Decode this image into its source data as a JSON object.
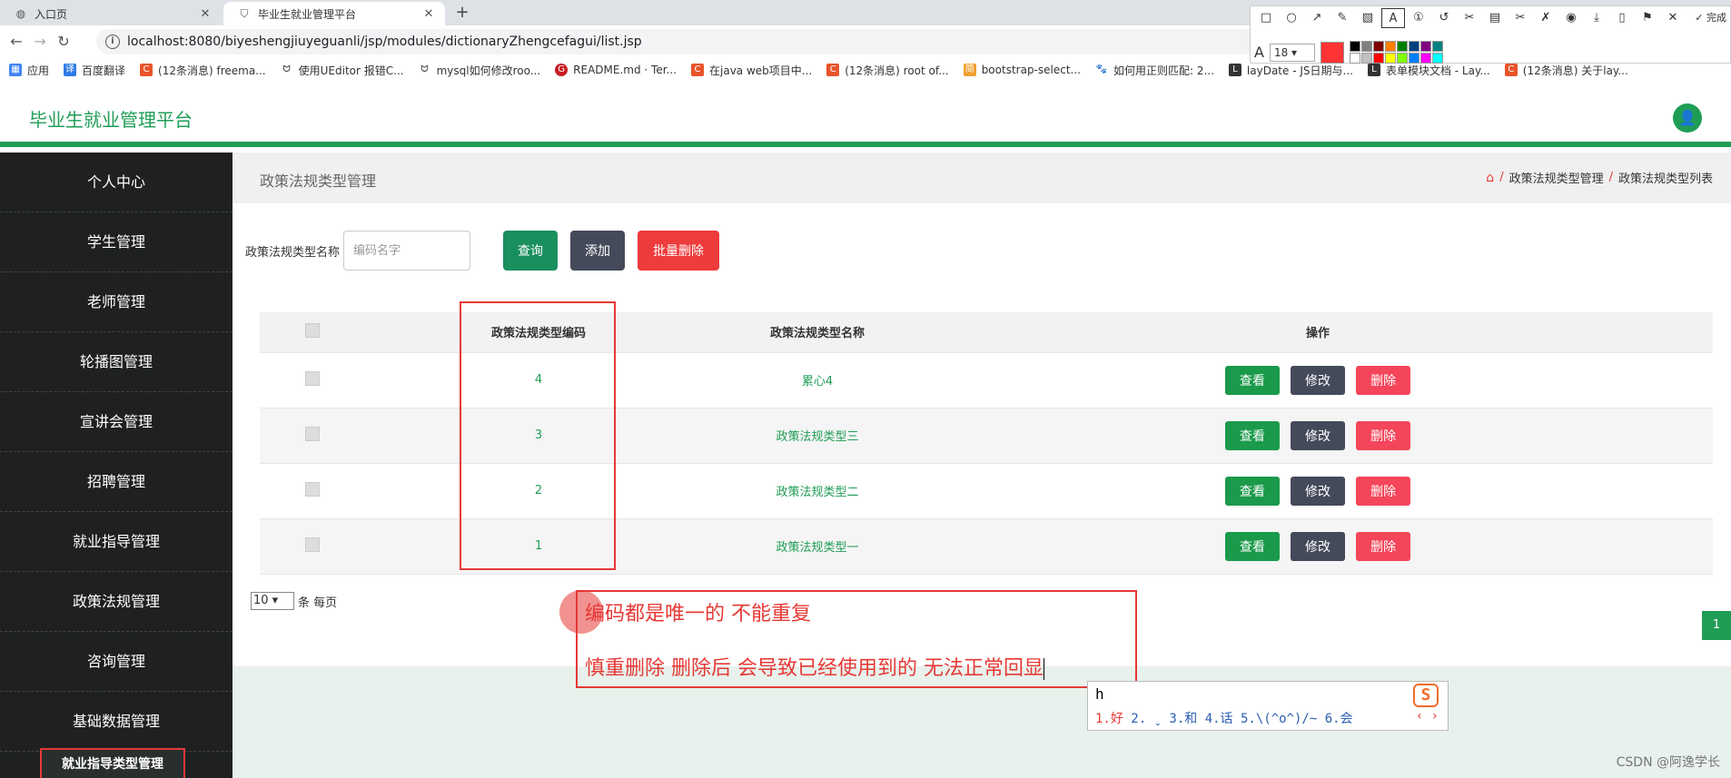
{
  "browser": {
    "tabs": [
      {
        "label": "入口页",
        "active": false
      },
      {
        "label": "毕业生就业管理平台",
        "active": true
      }
    ],
    "url": "localhost:8080/biyeshengjiuyeguanli/jsp/modules/dictionaryZhengcefagui/list.jsp",
    "bookmarks": [
      "应用",
      "百度翻译",
      "(12条消息) freema...",
      "使用UEditor 报错C...",
      "mysql如何修改roo...",
      "README.md · Ter...",
      "在java web项目中...",
      "(12条消息) root of...",
      "bootstrap-select...",
      "如何用正则匹配: 2...",
      "layDate - JS日期与...",
      "表单模块文档 - Lay...",
      "(12条消息) 关于lay..."
    ]
  },
  "snaptool": {
    "done_label": "完成",
    "font_size": "18",
    "current_color": "#ff3333",
    "palette": [
      "#000000",
      "#808080",
      "#800000",
      "#ff8000",
      "#008000",
      "#004080",
      "#800080",
      "#008080",
      "#ffffff",
      "#c0c0c0",
      "#ff0000",
      "#ffff00",
      "#80ff00",
      "#0080ff",
      "#ff00ff",
      "#00ffff"
    ]
  },
  "app": {
    "title": "毕业生就业管理平台",
    "accent": "#1f9d55"
  },
  "sidebar": {
    "items": [
      "个人中心",
      "学生管理",
      "老师管理",
      "轮播图管理",
      "宣讲会管理",
      "招聘管理",
      "就业指导管理",
      "政策法规管理",
      "咨询管理",
      "基础数据管理"
    ],
    "sub_item": "就业指导类型管理"
  },
  "page": {
    "title": "政策法规类型管理",
    "breadcrumb": [
      "政策法规类型管理",
      "政策法规类型列表"
    ]
  },
  "search": {
    "label": "政策法规类型名称",
    "placeholder": "编码名字",
    "search_button": "查询",
    "add_button": "添加",
    "bulk_delete_button": "批量删除"
  },
  "table": {
    "headers": {
      "code": "政策法规类型编码",
      "name": "政策法规类型名称",
      "ops": "操作"
    },
    "rows": [
      {
        "code": "4",
        "name": "累心4"
      },
      {
        "code": "3",
        "name": "政策法规类型三"
      },
      {
        "code": "2",
        "name": "政策法规类型二"
      },
      {
        "code": "1",
        "name": "政策法规类型一"
      }
    ],
    "op_labels": {
      "view": "查看",
      "edit": "修改",
      "delete": "删除"
    }
  },
  "pager": {
    "page_size": "10",
    "per_page_label": "条 每页",
    "current_page": "1"
  },
  "annotation": {
    "line1": "编码都是唯一的 不能重复",
    "line2": "慎重删除  删除后 会导致已经使用到的 无法正常回显"
  },
  "ime": {
    "input": "h",
    "candidates": "2.  ˬ 3.和  4.话  5.\\(^o^)/~  6.会",
    "first_candidate": "1.好",
    "logo": "S"
  },
  "watermark": "CSDN @阿逸学长"
}
